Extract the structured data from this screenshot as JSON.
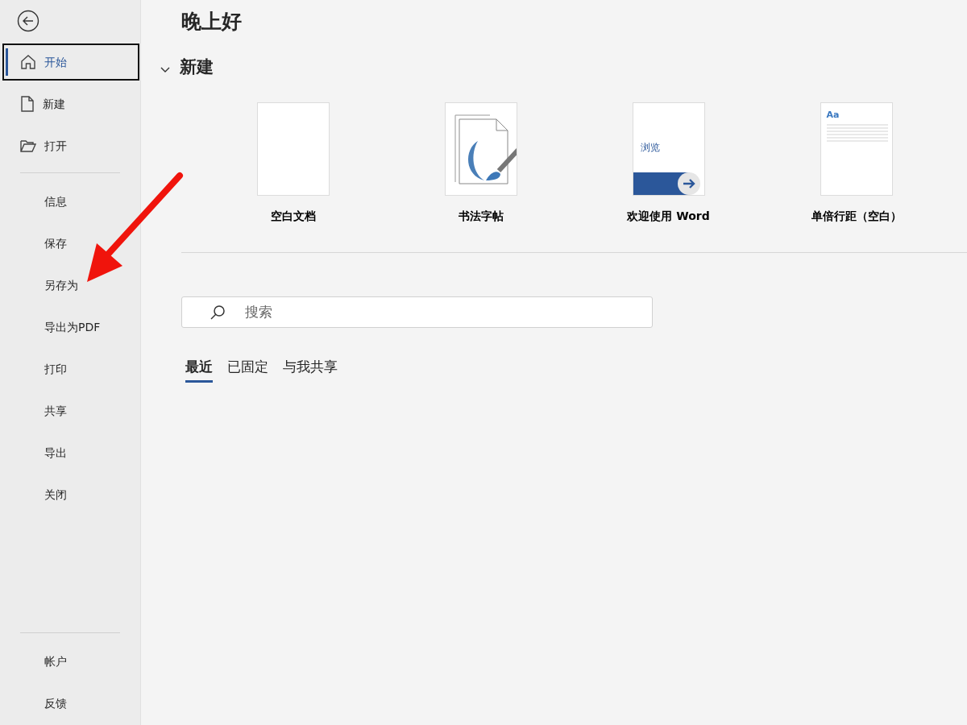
{
  "sidebar": {
    "groups": [
      {
        "items": [
          {
            "label": "开始",
            "selected": true
          },
          {
            "label": "新建",
            "selected": false
          },
          {
            "label": "打开",
            "selected": false
          }
        ]
      },
      {
        "items": [
          {
            "label": "信息",
            "selected": false
          },
          {
            "label": "保存",
            "selected": false
          },
          {
            "label": "另存为",
            "selected": false
          },
          {
            "label": "导出为PDF",
            "selected": false
          },
          {
            "label": "打印",
            "selected": false
          },
          {
            "label": "共享",
            "selected": false
          },
          {
            "label": "导出",
            "selected": false
          },
          {
            "label": "关闭",
            "selected": false
          }
        ]
      },
      {
        "items": [
          {
            "label": "帐户",
            "selected": false
          },
          {
            "label": "反馈",
            "selected": false
          }
        ]
      }
    ]
  },
  "greeting": "晚上好",
  "new_section": {
    "title": "新建",
    "expanded": true,
    "templates": [
      {
        "kind": "blank",
        "label": "空白文档"
      },
      {
        "kind": "calligraphy",
        "label": "书法字帖"
      },
      {
        "kind": "welcome",
        "label": "欢迎使用 Word",
        "thumb_text": "浏览"
      },
      {
        "kind": "lined",
        "label": "单倍行距（空白）",
        "thumb_text": "Aa"
      }
    ]
  },
  "search": {
    "placeholder": "搜索"
  },
  "tabs": [
    {
      "label": "最近",
      "selected": true
    },
    {
      "label": "已固定",
      "selected": false
    },
    {
      "label": "与我共享",
      "selected": false
    }
  ],
  "annotation_arrow": true
}
